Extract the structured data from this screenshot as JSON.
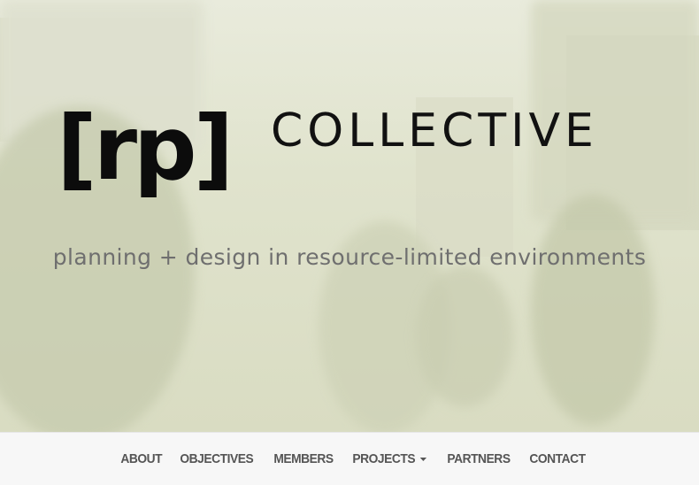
{
  "hero": {
    "logo_mark": "[rp]",
    "logo_word": "COLLECTIVE",
    "tagline": "planning + design in resource-limited environments"
  },
  "nav": {
    "items": [
      {
        "label": "ABOUT"
      },
      {
        "label": "OBJECTIVES"
      },
      {
        "label": "MEMBERS"
      },
      {
        "label": "PROJECTS",
        "dropdown": true
      },
      {
        "label": "PARTNERS"
      },
      {
        "label": "CONTACT"
      }
    ]
  },
  "colors": {
    "hero_tint": "#e0e3cd",
    "logo": "#0c0c0c",
    "tagline": "#6f6f6f",
    "nav_text": "#555555",
    "navbar_bg": "#f7f7f7"
  }
}
